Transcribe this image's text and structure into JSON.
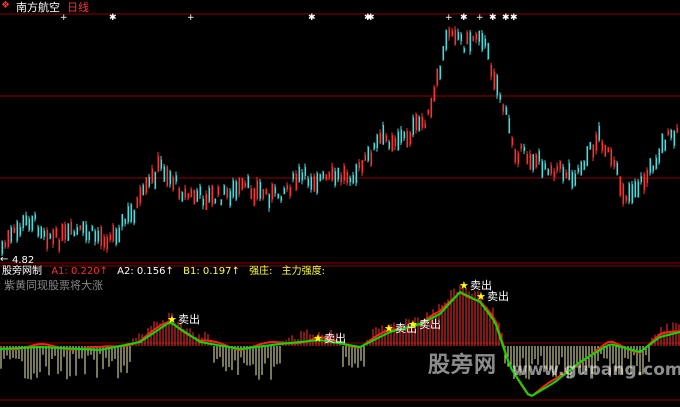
{
  "header": {
    "stock_name": "南方航空",
    "period": "日线",
    "logo_icon": "red-diamond-icon"
  },
  "price_panel": {
    "low_label": "4.82",
    "low_arrow": "←",
    "event_markers": [
      "+",
      "✱",
      "+",
      "✱",
      "✱",
      "✱",
      "+",
      "✱",
      "+",
      "✱",
      "✱",
      "✱"
    ]
  },
  "indicator": {
    "name": "股旁网制",
    "a1": "A1: 0.220↑",
    "a2": "A2: 0.156↑",
    "b1": "B1: 0.197↑",
    "s1": "强庄:",
    "s2": "主力强度:",
    "hint": "紫黄同现股票将大涨",
    "sell_label": "卖出"
  },
  "watermark": {
    "main": "股旁网",
    "url": "www.gupang.com"
  },
  "colors": {
    "background": "#000000",
    "grid": "#8b0000",
    "up": "#ff3030",
    "down": "#40e0e0",
    "green_line": "#00e000",
    "red_line": "#ff2020",
    "bar_red": "#ff3030",
    "bar_cream": "#f0f0b0",
    "star": "#ffff00"
  }
}
